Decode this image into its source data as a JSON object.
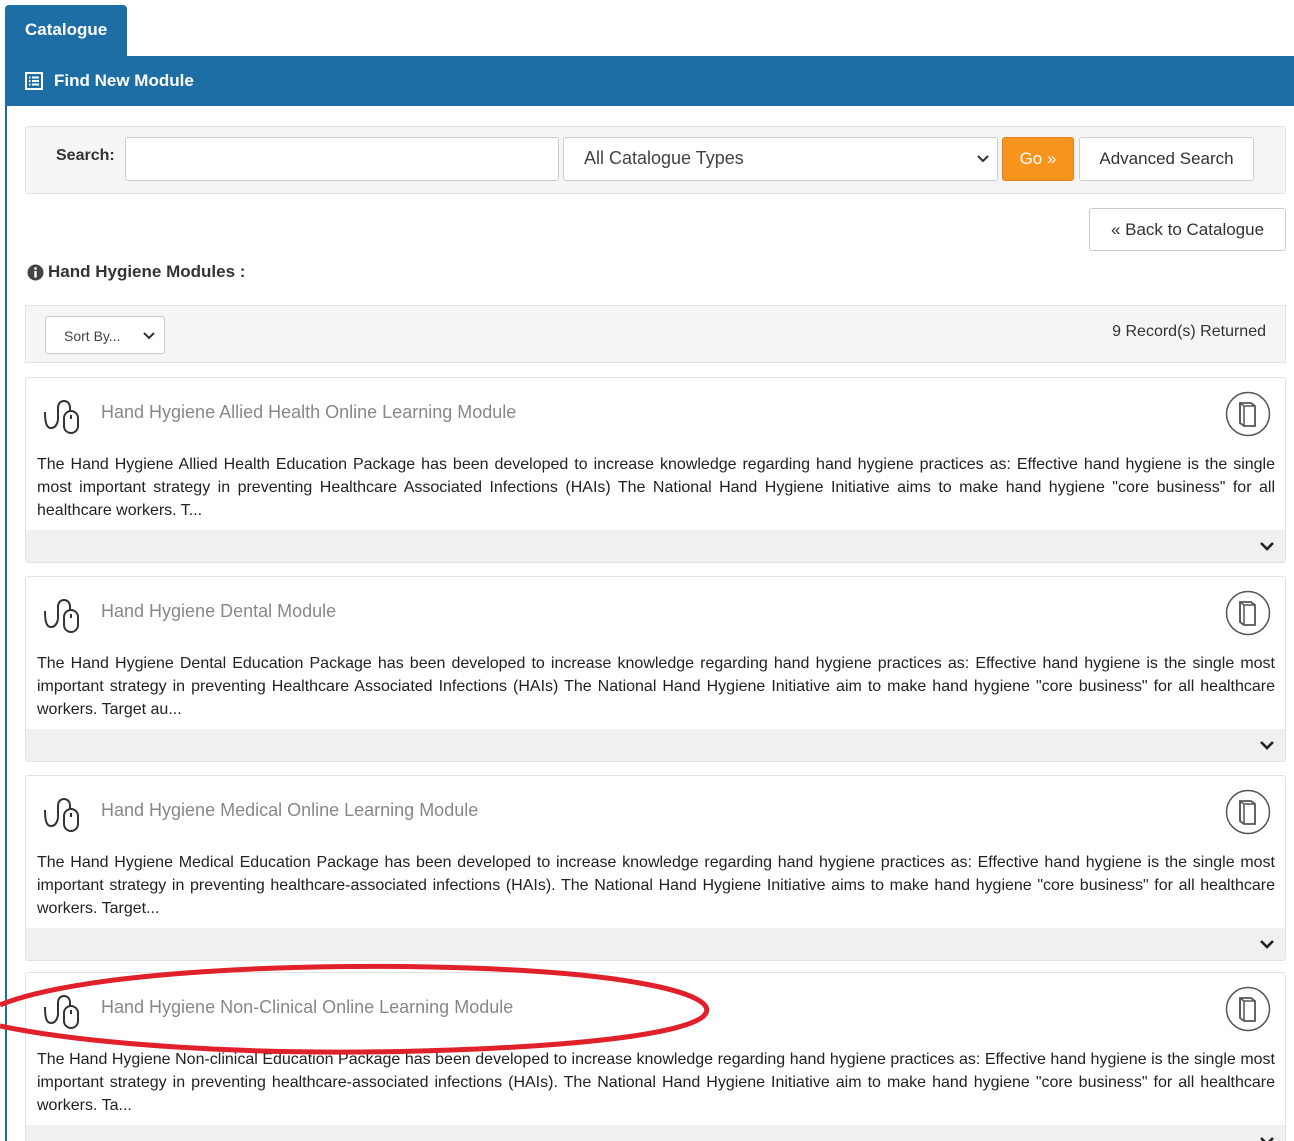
{
  "tabs": [
    {
      "label": "Catalogue"
    }
  ],
  "header": {
    "title": "Find New Module"
  },
  "search": {
    "label": "Search:",
    "value": "",
    "placeholder": "",
    "type_selected": "All Catalogue Types",
    "go_label": "Go »",
    "advanced_label": "Advanced Search"
  },
  "back_label": "« Back to Catalogue",
  "section": {
    "title": "Hand Hygiene Modules :"
  },
  "sort": {
    "selected": "Sort By...",
    "records": "9 Record(s) Returned"
  },
  "modules": [
    {
      "title": "Hand Hygiene Allied Health Online Learning Module",
      "description": "The Hand Hygiene Allied Health Education Package has been developed to increase knowledge regarding hand hygiene practices as: Effective hand hygiene is the single most important strategy in preventing Healthcare Associated Infections (HAIs) The National Hand Hygiene Initiative aims to make hand hygiene \"core business\" for all healthcare workers. T..."
    },
    {
      "title": "Hand Hygiene Dental Module",
      "description": "The Hand Hygiene Dental Education Package has been developed to increase knowledge regarding hand hygiene practices as: Effective hand hygiene is the single most important strategy in preventing Healthcare Associated Infections (HAIs) The National Hand Hygiene Initiative aim to make hand hygiene \"core business\" for all healthcare workers. Target au..."
    },
    {
      "title": "Hand Hygiene Medical Online Learning Module",
      "description": "The Hand Hygiene Medical Education Package has been developed to increase knowledge regarding hand hygiene practices as: Effective hand hygiene is the single most important strategy in preventing healthcare-associated infections (HAIs). The National Hand Hygiene Initiative aims to make hand hygiene \"core business\" for all healthcare workers. Target..."
    },
    {
      "title": "Hand Hygiene Non-Clinical Online Learning Module",
      "description": "The Hand Hygiene Non-clinical Education Package has been developed to increase knowledge regarding hand hygiene practices as: Effective hand hygiene is the single most important strategy in preventing healthcare-associated infections (HAIs). The National Hand Hygiene Initiative aim to make hand hygiene \"core business\" for all healthcare workers. Ta..."
    }
  ],
  "icons": {
    "header": "list-icon",
    "section": "info-circle-icon",
    "module_type": "mouse-icon",
    "module_action": "book-icon",
    "expand": "chevron-down-icon"
  },
  "colors": {
    "brand": "#1c6ea4",
    "accent": "#f7941d",
    "annotation": "#e0202a"
  }
}
